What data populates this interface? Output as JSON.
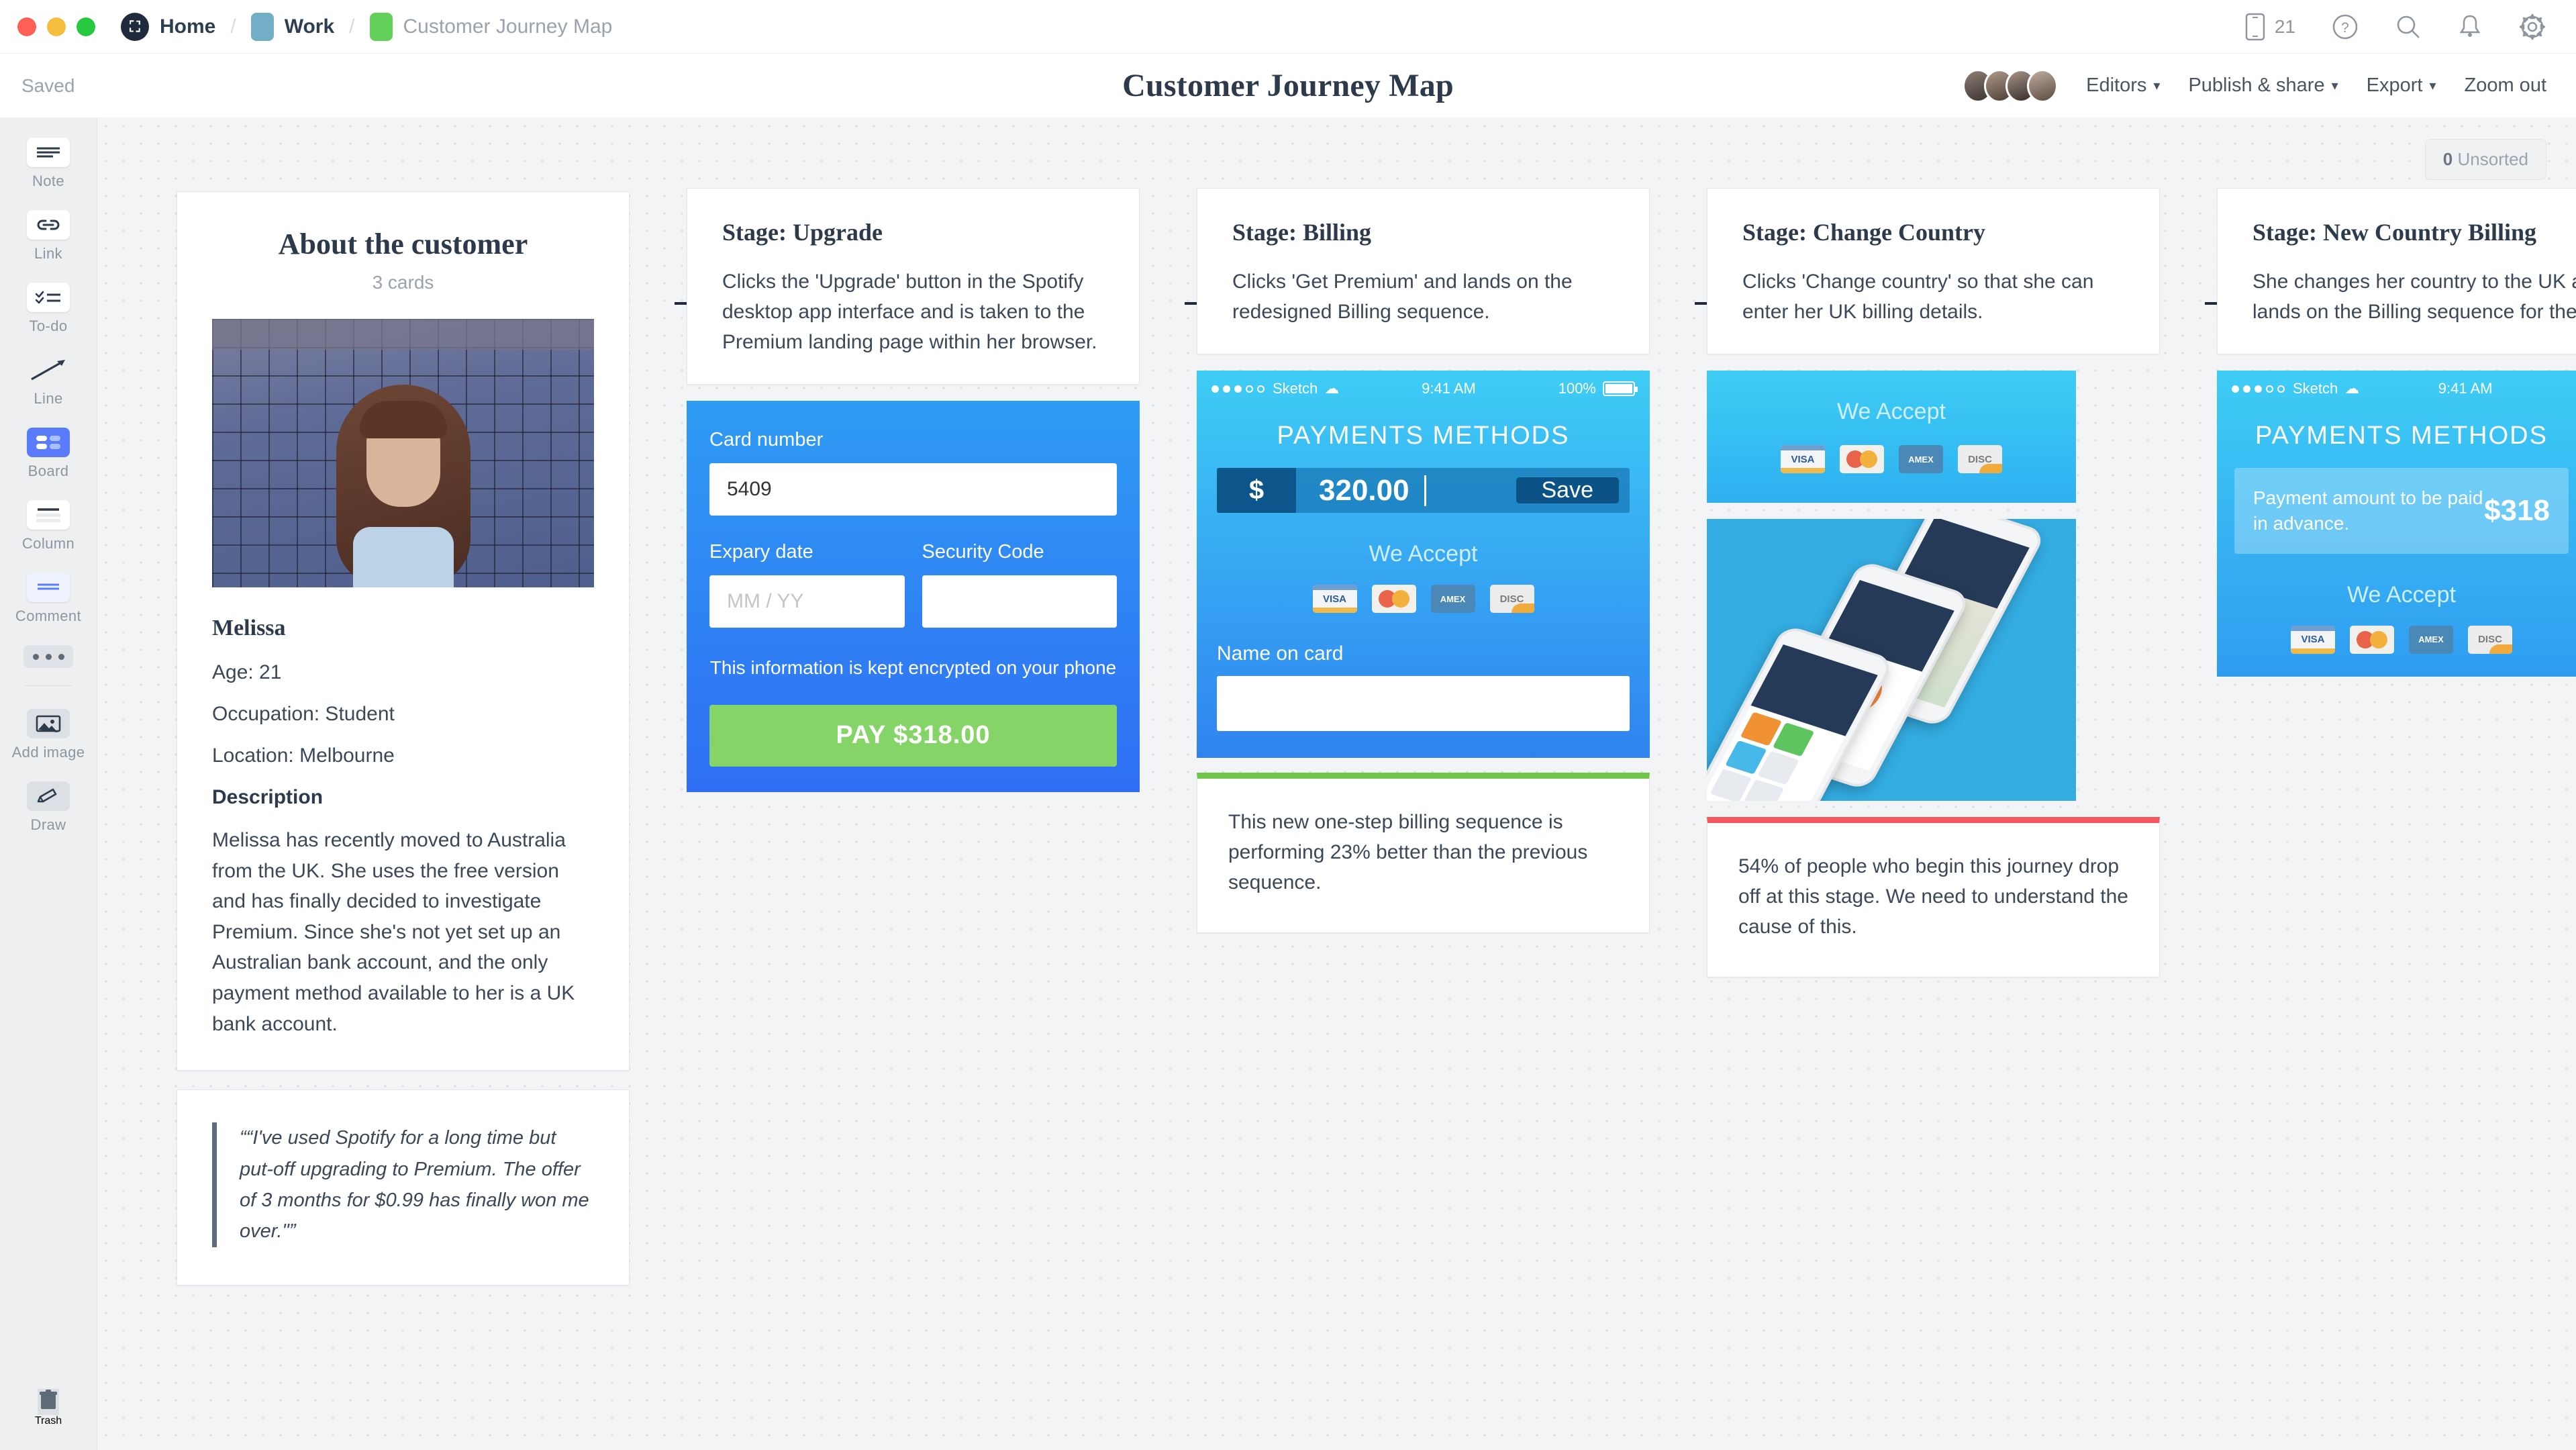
{
  "topbar": {
    "breadcrumb": [
      {
        "label": "Home",
        "type": "logo"
      },
      {
        "label": "Work",
        "type": "chip-work"
      },
      {
        "label": "Customer Journey Map",
        "type": "chip-board"
      }
    ],
    "mobile_count": "21",
    "icons": [
      "mobile-icon",
      "help-icon",
      "search-icon",
      "bell-icon",
      "gear-icon"
    ]
  },
  "subbar": {
    "save_status": "Saved",
    "title": "Customer Journey Map",
    "editors_label": "Editors",
    "publish_label": "Publish & share",
    "export_label": "Export",
    "zoom_label": "Zoom out"
  },
  "rail": {
    "tools": [
      {
        "label": "Note",
        "icon": "note-icon"
      },
      {
        "label": "Link",
        "icon": "link-icon"
      },
      {
        "label": "To-do",
        "icon": "todo-icon"
      },
      {
        "label": "Line",
        "icon": "line-icon"
      },
      {
        "label": "Board",
        "icon": "board-icon"
      },
      {
        "label": "Column",
        "icon": "column-icon"
      },
      {
        "label": "Comment",
        "icon": "comment-icon"
      },
      {
        "label": "Add image",
        "icon": "image-icon"
      },
      {
        "label": "Draw",
        "icon": "pencil-icon"
      }
    ],
    "more_icon": "ellipsis-icon",
    "trash_icon": "trash-icon",
    "trash_label": "Trash"
  },
  "canvas": {
    "unsorted_count": "0",
    "unsorted_label": "Unsorted"
  },
  "about": {
    "title": "About the customer",
    "cards_count": "3 cards",
    "name": "Melissa",
    "age": "Age: 21",
    "occupation": "Occupation: Student",
    "location": "Location: Melbourne",
    "description_heading": "Description",
    "description": "Melissa has recently moved to Australia from the UK. She uses the free version and has finally decided to investigate Premium. Since she's not yet set up an Australian bank account, and the only payment method available to her is a UK bank account.",
    "quote": "““I've used Spotify for a long time but put-off upgrading to Premium. The offer of 3 months for $0.99 has finally won me over.\"”"
  },
  "stages": [
    {
      "title": "Stage: Upgrade",
      "body": "Clicks the 'Upgrade' button in the Spotify desktop app interface and is taken to the Premium landing page within her browser."
    },
    {
      "title": "Stage: Billing",
      "body": "Clicks 'Get Premium' and lands on the redesigned Billing sequence."
    },
    {
      "title": "Stage: Change Country",
      "body": "Clicks 'Change country' so that she can enter her UK billing details."
    },
    {
      "title": "Stage: New Country Billing",
      "body": "She changes her country to the UK and lands on the Billing sequence for the UK"
    }
  ],
  "paycard": {
    "card_number_label": "Card number",
    "card_number_value": "5409",
    "expiry_label": "Expary date",
    "expiry_placeholder": "MM / YY",
    "security_label": "Security Code",
    "security_value": "",
    "encrypted_note": "This information is kept encrypted on your phone",
    "pay_button": "PAY $318.00"
  },
  "phone_billing": {
    "carrier": "Sketch",
    "time": "9:41 AM",
    "battery": "100%",
    "title": "PAYMENTS METHODS",
    "currency_symbol": "$",
    "amount": "320.00",
    "save_label": "Save",
    "we_accept": "We Accept",
    "cards": [
      "VISA",
      "MC",
      "AMEX",
      "DISC"
    ],
    "name_on_card_label": "Name on card",
    "name_on_card_value": ""
  },
  "note_billing": {
    "text": "This new one-step billing sequence is performing 23% better than the previous sequence."
  },
  "accept_banner": {
    "we_accept": "We Accept",
    "cards": [
      "VISA",
      "MC",
      "AMEX",
      "DISC"
    ]
  },
  "note_country": {
    "text": "54% of people who begin this journey drop off at this stage. We need to understand the cause of this."
  },
  "phone_newcountry": {
    "carrier": "Sketch",
    "time": "9:41 AM",
    "title": "PAYMENTS METHODS",
    "advance_text": "Payment amount to be paid in advance.",
    "advance_price": "$318",
    "we_accept": "We Accept",
    "cards": [
      "VISA",
      "MC",
      "AMEX",
      "DISC"
    ]
  },
  "colors": {
    "accent_blue": "#2f83f0",
    "cyan": "#3ecdf5",
    "green": "#6ec64b",
    "red": "#f4565b",
    "pay_green": "#84d468",
    "tool_active": "#5b7cfa",
    "ink": "#2d3a4b"
  }
}
